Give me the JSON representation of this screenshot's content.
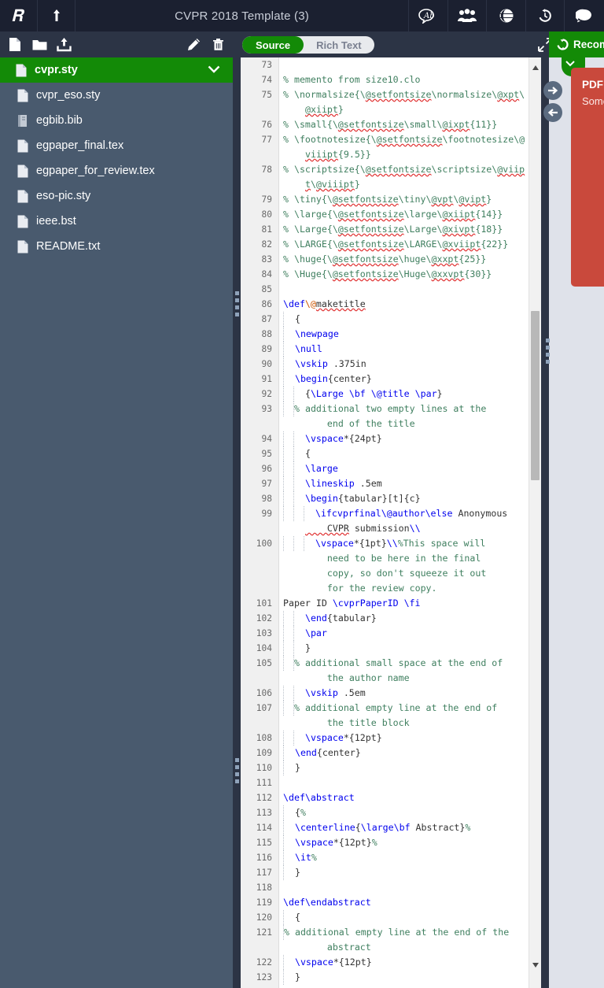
{
  "topbar": {
    "logo_icon": "overleaf-logo-icon",
    "back_icon": "back-to-projects-icon",
    "title": "CVPR 2018 Template (3)",
    "icons": [
      {
        "name": "spell-check-icon",
        "label": "Ab"
      },
      {
        "name": "share-people-icon",
        "label": ""
      },
      {
        "name": "publish-globe-icon",
        "label": ""
      },
      {
        "name": "history-icon",
        "label": ""
      },
      {
        "name": "chat-icon",
        "label": ""
      }
    ]
  },
  "toolbar": {
    "new_file_icon": "new-file-icon",
    "new_folder_icon": "new-folder-icon",
    "upload_icon": "upload-icon",
    "rename_icon": "pencil-rename-icon",
    "delete_icon": "trash-delete-icon",
    "expand_icon": "expand-editor-icon",
    "mode_source": "Source",
    "mode_rich_text": "Rich Text",
    "mode_selected": "Source"
  },
  "files": [
    {
      "name": "cvpr.sty",
      "icon": "file-icon",
      "selected": true
    },
    {
      "name": "cvpr_eso.sty",
      "icon": "file-icon",
      "selected": false
    },
    {
      "name": "egbib.bib",
      "icon": "bib-file-icon",
      "selected": false
    },
    {
      "name": "egpaper_final.tex",
      "icon": "file-icon",
      "selected": false
    },
    {
      "name": "egpaper_for_review.tex",
      "icon": "file-icon",
      "selected": false
    },
    {
      "name": "eso-pic.sty",
      "icon": "file-icon",
      "selected": false
    },
    {
      "name": "ieee.bst",
      "icon": "file-icon",
      "selected": false
    },
    {
      "name": "README.txt",
      "icon": "file-icon",
      "selected": false
    }
  ],
  "pdf_panel": {
    "recompile_label": "Recompile",
    "recompile_icon": "recompile-refresh-icon",
    "error_title": "PDF Rendering Error",
    "error_body": "Something went wrong while rendering this PDF.",
    "nav_forward_icon": "arrow-right-circle-icon",
    "nav_back_icon": "arrow-left-circle-icon"
  },
  "colors": {
    "accent_green": "#138a07",
    "topbar": "#1b2030",
    "toolbar": "#2c3445",
    "sidebar": "#495a6e",
    "error_red": "#c9493c",
    "comment": "#3f7f5f",
    "command": "#0000ee",
    "at_symbol": "#cc5500"
  },
  "editor": {
    "first_line": 73,
    "last_line": 123,
    "lines": [
      {
        "n": "73",
        "indent": 0,
        "tokens": []
      },
      {
        "n": "74",
        "indent": 0,
        "tokens": [
          {
            "t": "cm",
            "v": "% memento from size10.clo"
          }
        ]
      },
      {
        "n": "75",
        "indent": 0,
        "tokens": [
          {
            "t": "cm",
            "v": "% \\normalsize{\\"
          },
          {
            "t": "cms",
            "v": "@setfontsize"
          },
          {
            "t": "cm",
            "v": "\\normalsize\\"
          },
          {
            "t": "cms",
            "v": "@xpt"
          },
          {
            "t": "cm",
            "v": "\\"
          }
        ],
        "wrap": [
          {
            "t": "cms",
            "v": "@xiipt"
          },
          {
            "t": "cm",
            "v": "}"
          }
        ]
      },
      {
        "n": "76",
        "indent": 0,
        "tokens": [
          {
            "t": "cm",
            "v": "% \\small{\\"
          },
          {
            "t": "cms",
            "v": "@setfontsize"
          },
          {
            "t": "cm",
            "v": "\\small\\"
          },
          {
            "t": "cms",
            "v": "@ixpt"
          },
          {
            "t": "cm",
            "v": "{11}}"
          }
        ]
      },
      {
        "n": "77",
        "indent": 0,
        "tokens": [
          {
            "t": "cm",
            "v": "% \\footnotesize{\\"
          },
          {
            "t": "cms",
            "v": "@setfontsize"
          },
          {
            "t": "cm",
            "v": "\\footnotesize\\"
          },
          {
            "t": "cm",
            "v": "@"
          }
        ],
        "wrap": [
          {
            "t": "cms",
            "v": "viiipt"
          },
          {
            "t": "cm",
            "v": "{9.5}}"
          }
        ]
      },
      {
        "n": "78",
        "indent": 0,
        "tokens": [
          {
            "t": "cm",
            "v": "% \\scriptsize{\\"
          },
          {
            "t": "cms",
            "v": "@setfontsize"
          },
          {
            "t": "cm",
            "v": "\\scriptsize\\"
          },
          {
            "t": "cms",
            "v": "@viip"
          }
        ],
        "wrap": [
          {
            "t": "cms",
            "v": "t"
          },
          {
            "t": "cm",
            "v": "\\"
          },
          {
            "t": "cms",
            "v": "@viiipt"
          },
          {
            "t": "cm",
            "v": "}"
          }
        ]
      },
      {
        "n": "79",
        "indent": 0,
        "tokens": [
          {
            "t": "cm",
            "v": "% \\tiny{\\"
          },
          {
            "t": "cms",
            "v": "@setfontsize"
          },
          {
            "t": "cm",
            "v": "\\tiny\\"
          },
          {
            "t": "cms",
            "v": "@vpt"
          },
          {
            "t": "cm",
            "v": "\\"
          },
          {
            "t": "cms",
            "v": "@vipt"
          },
          {
            "t": "cm",
            "v": "}"
          }
        ]
      },
      {
        "n": "80",
        "indent": 0,
        "tokens": [
          {
            "t": "cm",
            "v": "% \\large{\\"
          },
          {
            "t": "cms",
            "v": "@setfontsize"
          },
          {
            "t": "cm",
            "v": "\\large\\"
          },
          {
            "t": "cms",
            "v": "@xiipt"
          },
          {
            "t": "cm",
            "v": "{14}}"
          }
        ]
      },
      {
        "n": "81",
        "indent": 0,
        "tokens": [
          {
            "t": "cm",
            "v": "% \\Large{\\"
          },
          {
            "t": "cms",
            "v": "@setfontsize"
          },
          {
            "t": "cm",
            "v": "\\Large\\"
          },
          {
            "t": "cms",
            "v": "@xivpt"
          },
          {
            "t": "cm",
            "v": "{18}}"
          }
        ]
      },
      {
        "n": "82",
        "indent": 0,
        "tokens": [
          {
            "t": "cm",
            "v": "% \\LARGE{\\"
          },
          {
            "t": "cms",
            "v": "@setfontsize"
          },
          {
            "t": "cm",
            "v": "\\LARGE\\"
          },
          {
            "t": "cms",
            "v": "@xviipt"
          },
          {
            "t": "cm",
            "v": "{22}}"
          }
        ]
      },
      {
        "n": "83",
        "indent": 0,
        "tokens": [
          {
            "t": "cm",
            "v": "% \\huge{\\"
          },
          {
            "t": "cms",
            "v": "@setfontsize"
          },
          {
            "t": "cm",
            "v": "\\huge\\"
          },
          {
            "t": "cms",
            "v": "@xxpt"
          },
          {
            "t": "cm",
            "v": "{25}}"
          }
        ]
      },
      {
        "n": "84",
        "indent": 0,
        "tokens": [
          {
            "t": "cm",
            "v": "% \\Huge{\\"
          },
          {
            "t": "cms",
            "v": "@setfontsize"
          },
          {
            "t": "cm",
            "v": "\\Huge\\"
          },
          {
            "t": "cms",
            "v": "@xxvpt"
          },
          {
            "t": "cm",
            "v": "{30}}"
          }
        ]
      },
      {
        "n": "85",
        "indent": 0,
        "tokens": []
      },
      {
        "n": "86",
        "indent": 0,
        "tokens": [
          {
            "t": "kw",
            "v": "\\def"
          },
          {
            "t": "at",
            "v": "\\@"
          },
          {
            "t": "pls",
            "v": "maketitle"
          }
        ]
      },
      {
        "n": "87",
        "indent": 1,
        "tokens": [
          {
            "t": "pl",
            "v": "  {"
          }
        ]
      },
      {
        "n": "88",
        "indent": 1,
        "tokens": [
          {
            "t": "kw",
            "v": "  \\newpage"
          }
        ]
      },
      {
        "n": "89",
        "indent": 1,
        "tokens": [
          {
            "t": "kw",
            "v": "  \\null"
          }
        ]
      },
      {
        "n": "90",
        "indent": 1,
        "tokens": [
          {
            "t": "kw",
            "v": "  \\vskip"
          },
          {
            "t": "pl",
            "v": " .375in"
          }
        ]
      },
      {
        "n": "91",
        "indent": 1,
        "tokens": [
          {
            "t": "kw",
            "v": "  \\begin"
          },
          {
            "t": "pl",
            "v": "{center}"
          }
        ]
      },
      {
        "n": "92",
        "indent": 2,
        "tokens": [
          {
            "t": "pl",
            "v": "  {"
          },
          {
            "t": "kw",
            "v": "\\Large"
          },
          {
            "t": "pl",
            "v": " "
          },
          {
            "t": "kw",
            "v": "\\bf"
          },
          {
            "t": "pl",
            "v": " "
          },
          {
            "t": "kw",
            "v": "\\@title"
          },
          {
            "t": "pl",
            "v": " "
          },
          {
            "t": "kw",
            "v": "\\par"
          },
          {
            "t": "pl",
            "v": "}"
          }
        ]
      },
      {
        "n": "93",
        "indent": 2,
        "tokens": [
          {
            "t": "cm",
            "v": "% additional two empty lines at the"
          }
        ],
        "wrap": [
          {
            "t": "cm",
            "v": "    end of the title"
          }
        ]
      },
      {
        "n": "94",
        "indent": 2,
        "tokens": [
          {
            "t": "kw",
            "v": "  \\vspace"
          },
          {
            "t": "pl",
            "v": "*{24pt}"
          }
        ]
      },
      {
        "n": "95",
        "indent": 2,
        "tokens": [
          {
            "t": "pl",
            "v": "  {"
          }
        ]
      },
      {
        "n": "96",
        "indent": 2,
        "tokens": [
          {
            "t": "kw",
            "v": "  \\large"
          }
        ]
      },
      {
        "n": "97",
        "indent": 2,
        "tokens": [
          {
            "t": "kw",
            "v": "  \\lineskip"
          },
          {
            "t": "pl",
            "v": " .5em"
          }
        ]
      },
      {
        "n": "98",
        "indent": 2,
        "tokens": [
          {
            "t": "kw",
            "v": "  \\begin"
          },
          {
            "t": "pl",
            "v": "{tabular}[t]{c}"
          }
        ]
      },
      {
        "n": "99",
        "indent": 3,
        "tokens": [
          {
            "t": "kw",
            "v": "  \\ifcvprfinal"
          },
          {
            "t": "kw",
            "v": "\\@author"
          },
          {
            "t": "kw",
            "v": "\\else"
          },
          {
            "t": "pl",
            "v": " Anonymous"
          }
        ],
        "wrap": [
          {
            "t": "pls",
            "v": "    CVPR"
          },
          {
            "t": "pl",
            "v": " submission"
          },
          {
            "t": "kw",
            "v": "\\\\"
          }
        ]
      },
      {
        "n": "100",
        "indent": 3,
        "tokens": [
          {
            "t": "kw",
            "v": "  \\vspace"
          },
          {
            "t": "pl",
            "v": "*{1pt}"
          },
          {
            "t": "kw",
            "v": "\\\\"
          },
          {
            "t": "cm",
            "v": "%This space will"
          }
        ],
        "wrap": [
          {
            "t": "cm",
            "v": "    need to be here in the final"
          },
          {
            "t": "br",
            "v": ""
          },
          {
            "t": "cm",
            "v": "    copy, so don't squeeze it out"
          },
          {
            "t": "br",
            "v": ""
          },
          {
            "t": "cm",
            "v": "    for the review copy."
          }
        ]
      },
      {
        "n": "101",
        "indent": 0,
        "tokens": [
          {
            "t": "pl",
            "v": "Paper ID "
          },
          {
            "t": "kw",
            "v": "\\cvprPaperID"
          },
          {
            "t": "pl",
            "v": " "
          },
          {
            "t": "kw",
            "v": "\\fi"
          }
        ]
      },
      {
        "n": "102",
        "indent": 2,
        "tokens": [
          {
            "t": "kw",
            "v": "  \\end"
          },
          {
            "t": "pl",
            "v": "{tabular}"
          }
        ]
      },
      {
        "n": "103",
        "indent": 2,
        "tokens": [
          {
            "t": "kw",
            "v": "  \\par"
          }
        ]
      },
      {
        "n": "104",
        "indent": 2,
        "tokens": [
          {
            "t": "pl",
            "v": "  }"
          }
        ]
      },
      {
        "n": "105",
        "indent": 2,
        "tokens": [
          {
            "t": "cm",
            "v": "% additional small space at the end of"
          }
        ],
        "wrap": [
          {
            "t": "cm",
            "v": "    the author name"
          }
        ]
      },
      {
        "n": "106",
        "indent": 2,
        "tokens": [
          {
            "t": "kw",
            "v": "  \\vskip"
          },
          {
            "t": "pl",
            "v": " .5em"
          }
        ]
      },
      {
        "n": "107",
        "indent": 2,
        "tokens": [
          {
            "t": "cm",
            "v": "% additional empty line at the end of"
          }
        ],
        "wrap": [
          {
            "t": "cm",
            "v": "    the title block"
          }
        ]
      },
      {
        "n": "108",
        "indent": 2,
        "tokens": [
          {
            "t": "kw",
            "v": "  \\vspace"
          },
          {
            "t": "pl",
            "v": "*{12pt}"
          }
        ]
      },
      {
        "n": "109",
        "indent": 1,
        "tokens": [
          {
            "t": "kw",
            "v": "  \\end"
          },
          {
            "t": "pl",
            "v": "{center}"
          }
        ]
      },
      {
        "n": "110",
        "indent": 1,
        "tokens": [
          {
            "t": "pl",
            "v": "  }"
          }
        ]
      },
      {
        "n": "111",
        "indent": 0,
        "tokens": []
      },
      {
        "n": "112",
        "indent": 0,
        "tokens": [
          {
            "t": "kw",
            "v": "\\def"
          },
          {
            "t": "kw",
            "v": "\\abstract"
          }
        ]
      },
      {
        "n": "113",
        "indent": 1,
        "tokens": [
          {
            "t": "pl",
            "v": "  {"
          },
          {
            "t": "cm",
            "v": "%"
          }
        ]
      },
      {
        "n": "114",
        "indent": 1,
        "tokens": [
          {
            "t": "kw",
            "v": "  \\centerline"
          },
          {
            "t": "pl",
            "v": "{"
          },
          {
            "t": "kw",
            "v": "\\large"
          },
          {
            "t": "kw",
            "v": "\\bf"
          },
          {
            "t": "pl",
            "v": " Abstract}"
          },
          {
            "t": "cm",
            "v": "%"
          }
        ]
      },
      {
        "n": "115",
        "indent": 1,
        "tokens": [
          {
            "t": "kw",
            "v": "  \\vspace"
          },
          {
            "t": "pl",
            "v": "*{12pt}"
          },
          {
            "t": "cm",
            "v": "%"
          }
        ]
      },
      {
        "n": "116",
        "indent": 1,
        "tokens": [
          {
            "t": "kw",
            "v": "  \\it"
          },
          {
            "t": "cm",
            "v": "%"
          }
        ]
      },
      {
        "n": "117",
        "indent": 1,
        "tokens": [
          {
            "t": "pl",
            "v": "  }"
          }
        ]
      },
      {
        "n": "118",
        "indent": 0,
        "tokens": []
      },
      {
        "n": "119",
        "indent": 0,
        "tokens": [
          {
            "t": "kw",
            "v": "\\def"
          },
          {
            "t": "kw",
            "v": "\\endabstract"
          }
        ]
      },
      {
        "n": "120",
        "indent": 1,
        "tokens": [
          {
            "t": "pl",
            "v": "  {"
          }
        ]
      },
      {
        "n": "121",
        "indent": 1,
        "tokens": [
          {
            "t": "cm",
            "v": "% additional empty line at the end of the"
          }
        ],
        "wrap": [
          {
            "t": "cm",
            "v": "    abstract"
          }
        ]
      },
      {
        "n": "122",
        "indent": 1,
        "tokens": [
          {
            "t": "kw",
            "v": "  \\vspace"
          },
          {
            "t": "pl",
            "v": "*{12pt}"
          }
        ]
      },
      {
        "n": "123",
        "indent": 1,
        "tokens": [
          {
            "t": "pl",
            "v": "  }"
          }
        ]
      }
    ]
  }
}
